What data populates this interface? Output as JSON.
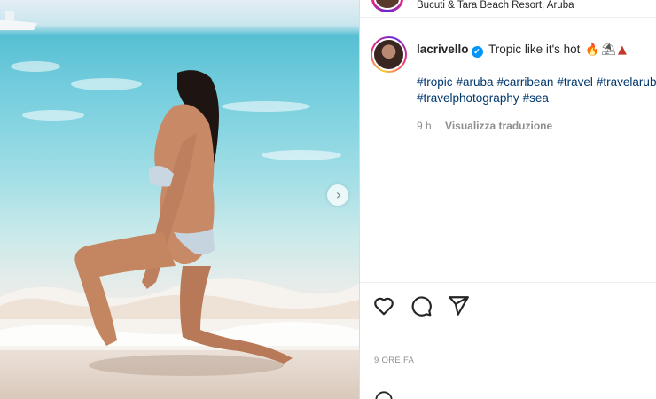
{
  "post": {
    "location": "Bucuti & Tara Beach Resort, Aruba",
    "username": "lacrivello",
    "caption_text": "Tropic like it's hot",
    "caption_emojis": [
      "fire-emoji",
      "beach-emoji",
      "volcano-emoji"
    ],
    "hashtags": [
      "#tropic",
      "#aruba",
      "#carribean",
      "#travel",
      "#travelaruba",
      "#travelphotography",
      "#sea"
    ],
    "age_short": "9 h",
    "translate_label": "Visualizza traduzione",
    "age_long": "9 ORE FA"
  },
  "icons": {
    "next": "chevron-right-icon",
    "like": "heart-icon",
    "comment": "comment-icon",
    "share": "paper-plane-icon",
    "verified": "verified-badge-icon"
  },
  "colors": {
    "link": "#00376b",
    "verified": "#0095f6",
    "muted": "#8e8e8e",
    "border": "#dbdbdb"
  }
}
